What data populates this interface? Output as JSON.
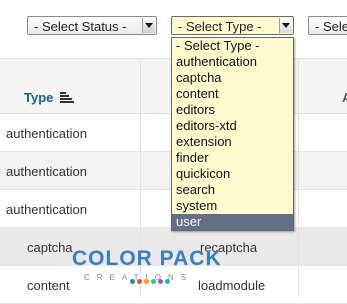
{
  "filters": {
    "status_select": {
      "value": "- Select Status -"
    },
    "type_select": {
      "value": "- Select Type -"
    },
    "third_select": {
      "value": "- Sele"
    }
  },
  "type_dropdown": {
    "options": [
      "- Select Type -",
      "authentication",
      "captcha",
      "content",
      "editors",
      "editors-xtd",
      "extension",
      "finder",
      "quickicon",
      "search",
      "system",
      "user"
    ],
    "highlighted_index": 11
  },
  "table": {
    "type_header": "Type",
    "third_header": "A",
    "rows": [
      {
        "type": "authentication",
        "name": ""
      },
      {
        "type": "authentication",
        "name": ""
      },
      {
        "type": "authentication",
        "name": ""
      },
      {
        "type": "captcha",
        "name": "recaptcha"
      },
      {
        "type": "content",
        "name": "loadmodule"
      }
    ]
  },
  "watermark": {
    "brand": "COLOR PACK",
    "sub": "CREATIONS",
    "colors": [
      "#3a7ec0",
      "#e74c3c",
      "#f39c12",
      "#2ecc71",
      "#9b59b6",
      "#1abc9c"
    ]
  },
  "colors": {
    "accent_header": "#1b5c8f",
    "dropdown_bg": "#fffbcf",
    "selected_option_bg": "#636f86"
  }
}
